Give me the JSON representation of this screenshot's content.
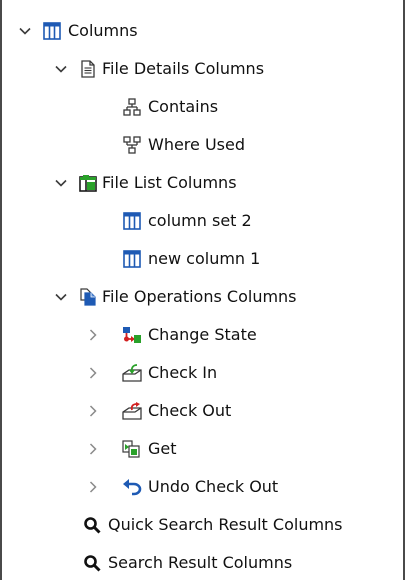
{
  "tree": {
    "root": {
      "label": "Columns",
      "icon": "column-set-icon",
      "expanded": true
    },
    "file_details": {
      "label": "File Details Columns",
      "icon": "document-icon",
      "expanded": true,
      "children": [
        {
          "label": "Contains",
          "icon": "hierarchy-icon"
        },
        {
          "label": "Where Used",
          "icon": "where-used-icon"
        }
      ]
    },
    "file_list": {
      "label": "File List Columns",
      "icon": "file-list-icon",
      "expanded": true,
      "children": [
        {
          "label": "column set 2",
          "icon": "column-set-icon"
        },
        {
          "label": "new column 1",
          "icon": "column-set-icon"
        }
      ]
    },
    "file_operations": {
      "label": "File Operations Columns",
      "icon": "file-operations-icon",
      "expanded": true,
      "children": [
        {
          "label": "Change State",
          "icon": "change-state-icon",
          "expanded": false
        },
        {
          "label": "Check In",
          "icon": "check-in-icon",
          "expanded": false
        },
        {
          "label": "Check Out",
          "icon": "check-out-icon",
          "expanded": false
        },
        {
          "label": "Get",
          "icon": "get-icon",
          "expanded": false
        },
        {
          "label": "Undo Check Out",
          "icon": "undo-icon",
          "expanded": false
        }
      ]
    },
    "quick_search": {
      "label": "Quick Search Result Columns",
      "icon": "search-icon"
    },
    "search": {
      "label": "Search Result Columns",
      "icon": "search-icon"
    }
  },
  "colors": {
    "column_icon": "#1e5ab4",
    "file_list_icon": "#2aa12a",
    "change_state_red": "#d22020",
    "change_state_green": "#2aa12a",
    "check_out_red": "#d22020",
    "undo_blue": "#1e5ab4"
  }
}
